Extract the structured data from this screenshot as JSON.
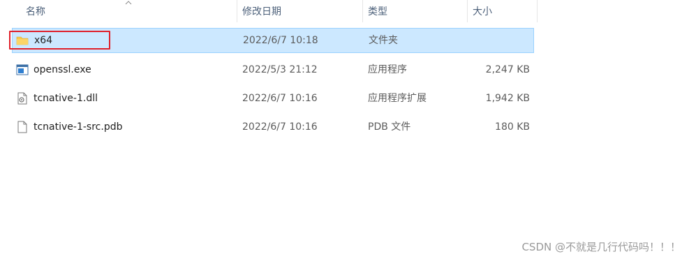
{
  "columns": {
    "name": "名称",
    "date": "修改日期",
    "type": "类型",
    "size": "大小"
  },
  "files": [
    {
      "name": "x64",
      "date": "2022/6/7 10:18",
      "type": "文件夹",
      "size": "",
      "icon": "folder-icon",
      "selected": true
    },
    {
      "name": "openssl.exe",
      "date": "2022/5/3 21:12",
      "type": "应用程序",
      "size": "2,247 KB",
      "icon": "exe-icon"
    },
    {
      "name": "tcnative-1.dll",
      "date": "2022/6/7 10:16",
      "type": "应用程序扩展",
      "size": "1,942 KB",
      "icon": "dll-icon"
    },
    {
      "name": "tcnative-1-src.pdb",
      "date": "2022/6/7 10:16",
      "type": "PDB 文件",
      "size": "180 KB",
      "icon": "file-icon"
    }
  ],
  "watermark": "CSDN @不就是几行代码吗！！！",
  "colors": {
    "selection_bg": "#cce8ff",
    "selection_border": "#99d1ff",
    "annotation_box": "#e0202a",
    "folder_yellow": "#f8c94a"
  }
}
